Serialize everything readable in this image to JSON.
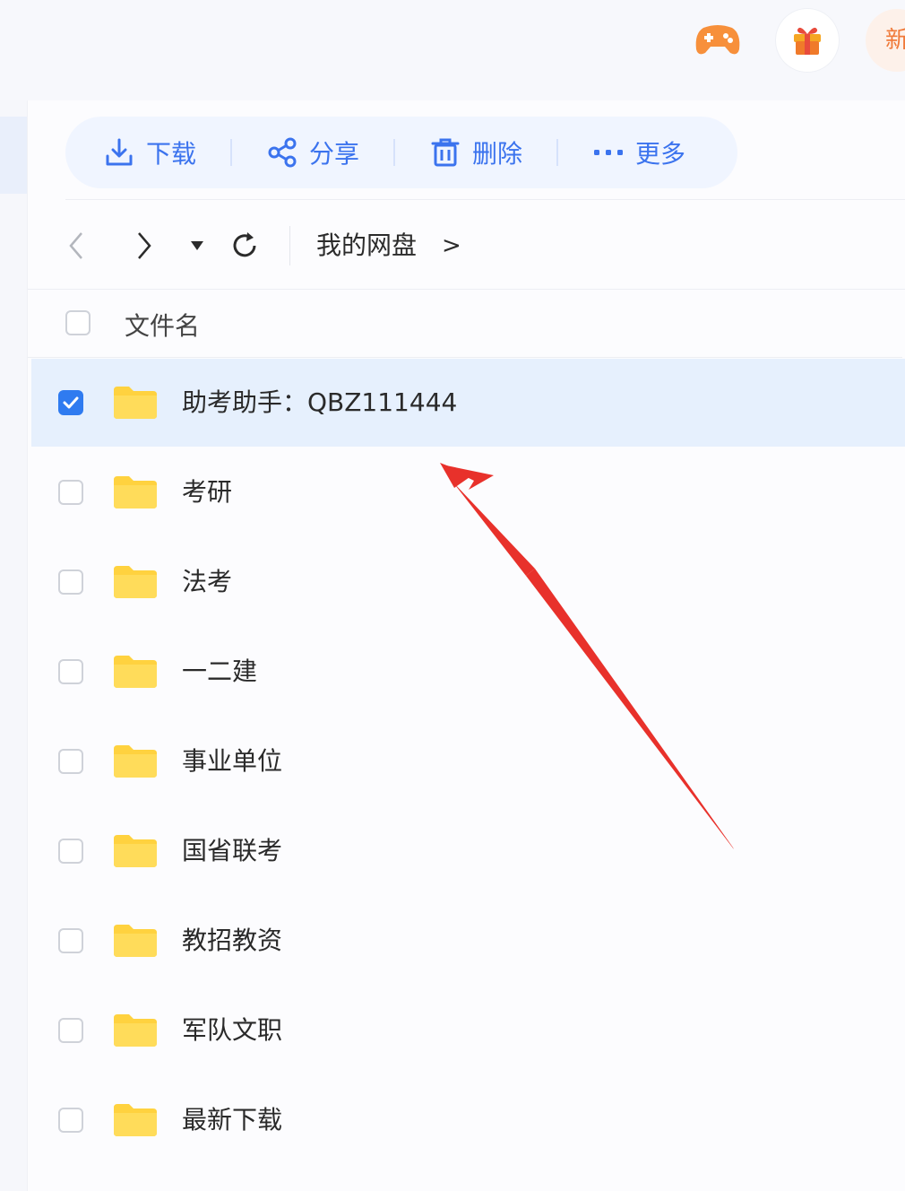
{
  "header": {
    "icons": [
      "gamepad-icon",
      "gift-icon"
    ],
    "new_label": "新"
  },
  "toolbar": {
    "download_label": "下载",
    "share_label": "分享",
    "delete_label": "删除",
    "more_label": "更多"
  },
  "nav": {
    "breadcrumb": "我的网盘",
    "breadcrumb_separator": ">"
  },
  "list": {
    "column_name": "文件名",
    "items": [
      {
        "name": "助考助手：QBZ111444",
        "selected": true
      },
      {
        "name": "考研",
        "selected": false
      },
      {
        "name": "法考",
        "selected": false
      },
      {
        "name": "一二建",
        "selected": false
      },
      {
        "name": "事业单位",
        "selected": false
      },
      {
        "name": "国省联考",
        "selected": false
      },
      {
        "name": "教招教资",
        "selected": false
      },
      {
        "name": "军队文职",
        "selected": false
      },
      {
        "name": "最新下载",
        "selected": false
      }
    ]
  },
  "colors": {
    "accent": "#3b73ee",
    "folder": "#ffd23f",
    "selection": "#e6f0fd",
    "annotation": "#e8312b"
  }
}
